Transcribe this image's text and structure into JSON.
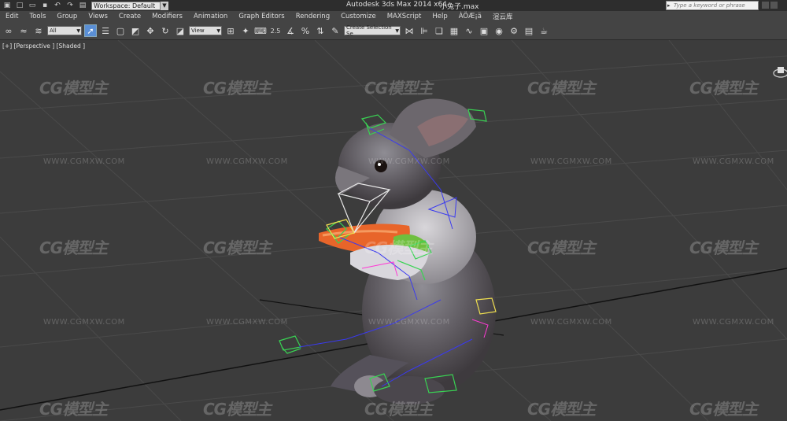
{
  "titlebar": {
    "app_title": "Autodesk 3ds Max  2014 x64",
    "file_name": "小兔子.max",
    "workspace": "Workspace: Default",
    "search_placeholder": "Type a keyword or phrase"
  },
  "menu": [
    "Edit",
    "Tools",
    "Group",
    "Views",
    "Create",
    "Modifiers",
    "Animation",
    "Graph Editors",
    "Rendering",
    "Customize",
    "MAXScript",
    "Help",
    "ÀÖÆ¡ä",
    "渲云库"
  ],
  "toolbar": {
    "selection_filter": "All",
    "reference_coord": "View",
    "named_selection": "Create Selection Se",
    "snap_label": "2.5"
  },
  "viewport": {
    "label": "[+] [Perspective ] [Shaded ]",
    "watermark_logo": "CG模型主",
    "watermark_url": "WWW.CGMXW.COM"
  },
  "colors": {
    "title_bg": "#2d2d2d",
    "menu_bg": "#444444",
    "viewport_bg": "#3c3c3c",
    "active_tool": "#5a8fd6",
    "bone_green": "#39d353"
  }
}
